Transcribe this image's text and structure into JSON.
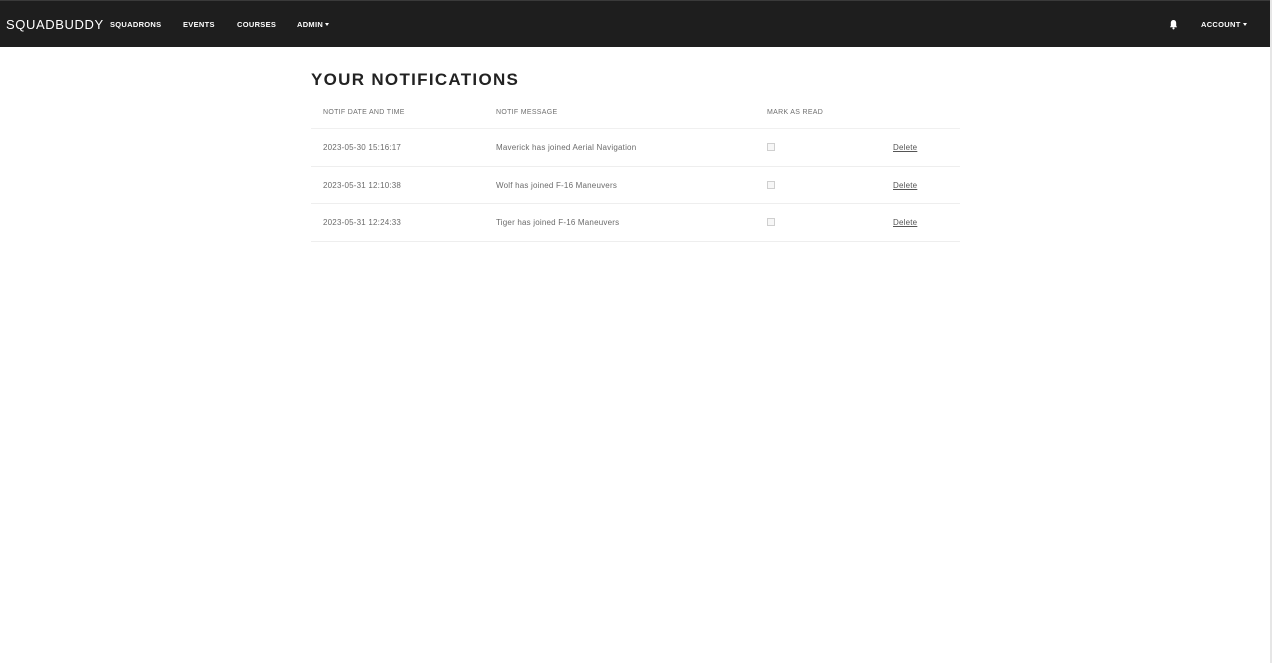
{
  "navbar": {
    "brand": "SQUADBUDDY",
    "links": {
      "squadrons": "SQUADRONS",
      "events": "EVENTS",
      "courses": "COURSES",
      "admin": "ADMIN"
    },
    "account": "ACCOUNT",
    "bell_icon": "bell-icon",
    "background_color": "#1e1e1e"
  },
  "page": {
    "title": "YOUR NOTIFICATIONS"
  },
  "table": {
    "headers": {
      "date": "NOTIF DATE AND TIME",
      "message": "NOTIF MESSAGE",
      "mark_read": "MARK AS READ"
    },
    "rows": [
      {
        "datetime": "2023-05-30 15:16:17",
        "message": "Maverick has joined Aerial Navigation",
        "read": false,
        "delete_label": "Delete"
      },
      {
        "datetime": "2023-05-31 12:10:38",
        "message": "Wolf has joined F-16 Maneuvers",
        "read": false,
        "delete_label": "Delete"
      },
      {
        "datetime": "2023-05-31 12:24:33",
        "message": "Tiger has joined F-16 Maneuvers",
        "read": false,
        "delete_label": "Delete"
      }
    ]
  }
}
